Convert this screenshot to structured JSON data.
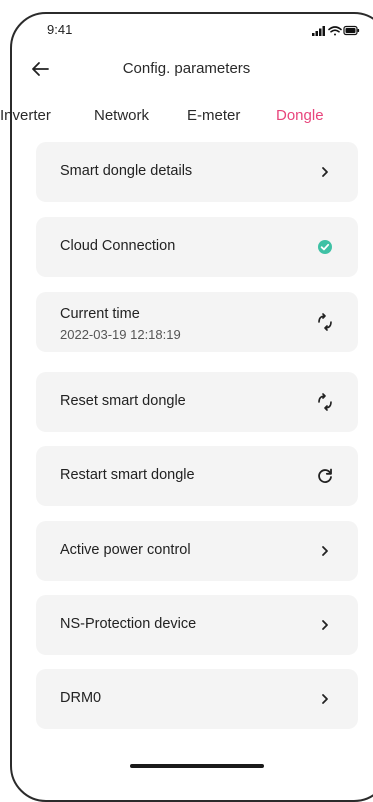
{
  "status_bar": {
    "time": "9:41"
  },
  "header": {
    "title": "Config. parameters"
  },
  "tabs": [
    {
      "label": "Inverter",
      "active": false
    },
    {
      "label": "Network",
      "active": false
    },
    {
      "label": "E-meter",
      "active": false
    },
    {
      "label": "Dongle",
      "active": true
    }
  ],
  "colors": {
    "accent": "#e8457c",
    "success": "#3fc1a5",
    "card_bg": "#f4f4f4"
  },
  "items": [
    {
      "label": "Smart dongle details",
      "icon": "chevron-right-icon"
    },
    {
      "label": "Cloud Connection",
      "icon": "check-circle-icon"
    },
    {
      "label": "Current time",
      "value": "2022-03-19 12:18:19",
      "icon": "sync-icon"
    },
    {
      "label": "Reset smart dongle",
      "icon": "sync-icon"
    },
    {
      "label": "Restart smart dongle",
      "icon": "refresh-icon"
    },
    {
      "label": "Active power control",
      "icon": "chevron-right-icon"
    },
    {
      "label": "NS-Protection device",
      "icon": "chevron-right-icon"
    },
    {
      "label": "DRM0",
      "icon": "chevron-right-icon"
    }
  ]
}
